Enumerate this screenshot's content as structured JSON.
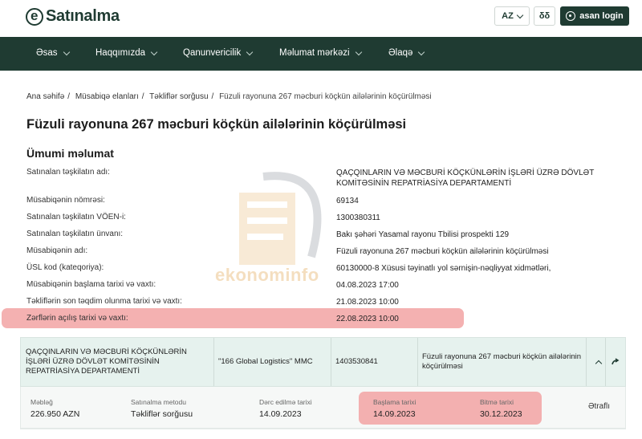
{
  "header": {
    "logo_text": "Satınalma",
    "lang": "AZ",
    "accessibility": "δδ",
    "asan_login": "asan login"
  },
  "nav": {
    "items": [
      {
        "label": "Əsas"
      },
      {
        "label": "Haqqımızda"
      },
      {
        "label": "Qanunvericilik"
      },
      {
        "label": "Məlumat mərkəzi"
      },
      {
        "label": "Əlaqə"
      }
    ]
  },
  "breadcrumb": {
    "items": [
      "Ana səhifə",
      "Müsabiqə elanları",
      "Təkliflər sorğusu"
    ],
    "current": "Füzuli rayonuna 267 məcburi köçkün ailələrinin köçürülməsi"
  },
  "page": {
    "title": "Füzuli rayonuna 267 məcburi köçkün ailələrinin köçürülməsi",
    "section_title": "Ümumi məlumat"
  },
  "info": [
    {
      "label": "Satınalan təşkilatın adı:",
      "value": "QAÇQINLARIN VƏ MƏCBURİ KÖÇKÜNLƏRİN İŞLƏRİ ÜZRƏ DÖVLƏT KOMİTƏSİNİN REPATRİASİYA DEPARTAMENTİ"
    },
    {
      "label": "Müsabiqənin nömrəsi:",
      "value": "69134"
    },
    {
      "label": "Satınalan təşkilatın VÖEN-i:",
      "value": "1300380311"
    },
    {
      "label": "Satınalan təşkilatın ünvanı:",
      "value": "Bakı şəhəri Yasamal rayonu Tbilisi prospekti 129"
    },
    {
      "label": "Müsabiqənin adı:",
      "value": "Füzuli rayonuna 267 məcburi köçkün ailələrinin köçürülməsi"
    },
    {
      "label": "ÜSL kod (kateqoriya):",
      "value": "60130000-8 Xüsusi təyinatlı yol sərnişin-nəqliyyat xidmətləri,"
    },
    {
      "label": "Müsabiqənin başlama tarixi və vaxtı:",
      "value": "04.08.2023 17:00"
    },
    {
      "label": "Təkliflərin son təqdim olunma tarixi və vaxtı:",
      "value": "21.08.2023 10:00"
    },
    {
      "label": "Zərflərin açılış tarixi və vaxtı:",
      "value": "22.08.2023 10:00"
    }
  ],
  "watermark": "ekonominfo",
  "result": {
    "organization": "QAÇQINLARIN VƏ MƏCBURİ KÖÇKÜNLƏRİN İŞLƏRİ ÜZRƏ DÖVLƏT KOMİTƏSİNİN REPATRİASİYA DEPARTAMENTİ",
    "winner": "\"166 Global Logistics\" MMC",
    "voen": "1403530841",
    "subject": "Füzuli rayonuna 267 məcburi köçkün ailələrinin köçürülməsi",
    "details": {
      "amount_label": "Məbləğ",
      "amount": "226.950 AZN",
      "method_label": "Satınalma metodu",
      "method": "Təkliflər sorğusu",
      "published_label": "Dərc edilmə tarixi",
      "published": "14.09.2023",
      "start_label": "Başlama tarixi",
      "start": "14.09.2023",
      "end_label": "Bitmə tarixi",
      "end": "30.12.2023",
      "more": "Ətraflı"
    }
  },
  "colors": {
    "brand": "#1f3b32",
    "highlight": "#f2a3a3",
    "row_bg": "#e6f2ee"
  }
}
